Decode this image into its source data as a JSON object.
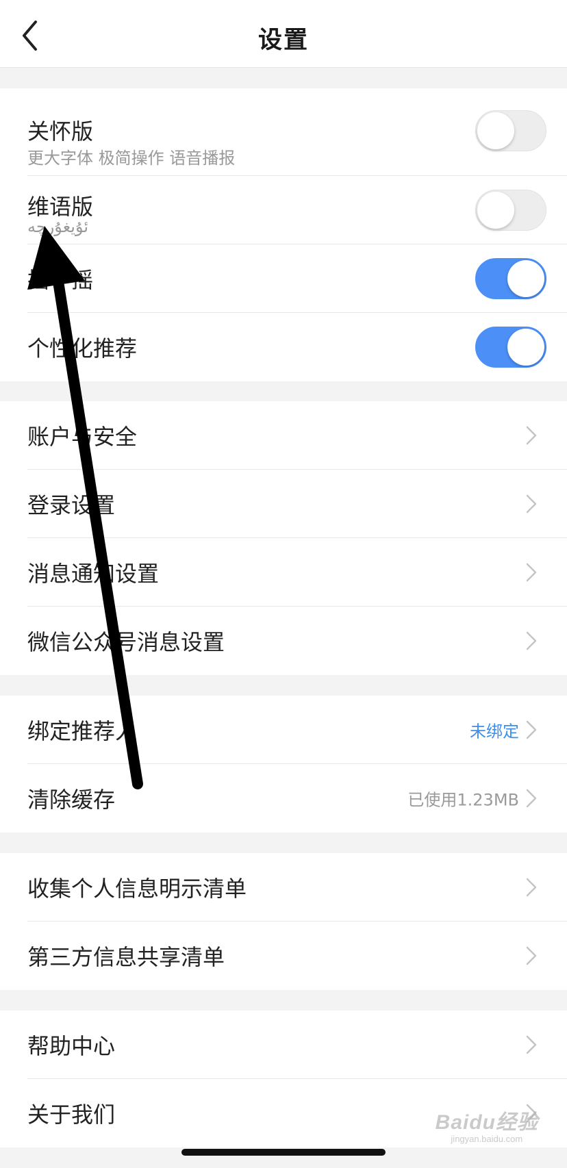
{
  "nav": {
    "title": "设置",
    "back_icon": "chevron-left-icon"
  },
  "groups": [
    {
      "rows": [
        {
          "label": "关怀版",
          "sub": "更大字体 极简操作 语音播报",
          "toggle": false
        },
        {
          "label": "维语版",
          "sub": "ئۇيغۇرچە",
          "toggle": false
        },
        {
          "label": "摇一摇",
          "toggle": true
        },
        {
          "label": "个性化推荐",
          "toggle": true
        }
      ]
    },
    {
      "rows": [
        {
          "label": "账户与安全"
        },
        {
          "label": "登录设置"
        },
        {
          "label": "消息通知设置"
        },
        {
          "label": "微信公众号消息设置"
        }
      ]
    },
    {
      "rows": [
        {
          "label": "绑定推荐人",
          "value": "未绑定"
        },
        {
          "label": "清除缓存",
          "value": "已使用1.23MB"
        }
      ]
    },
    {
      "rows": [
        {
          "label": "收集个人信息明示清单"
        },
        {
          "label": "第三方信息共享清单"
        }
      ]
    },
    {
      "rows": [
        {
          "label": "帮助中心"
        },
        {
          "label": "关于我们"
        }
      ]
    }
  ],
  "watermark": {
    "main": "Baidu经验",
    "sub": "jingyan.baidu.com"
  },
  "colors": {
    "toggle_on": "#4b8ff7",
    "link": "#3d8ef0",
    "background": "#f3f3f3"
  }
}
